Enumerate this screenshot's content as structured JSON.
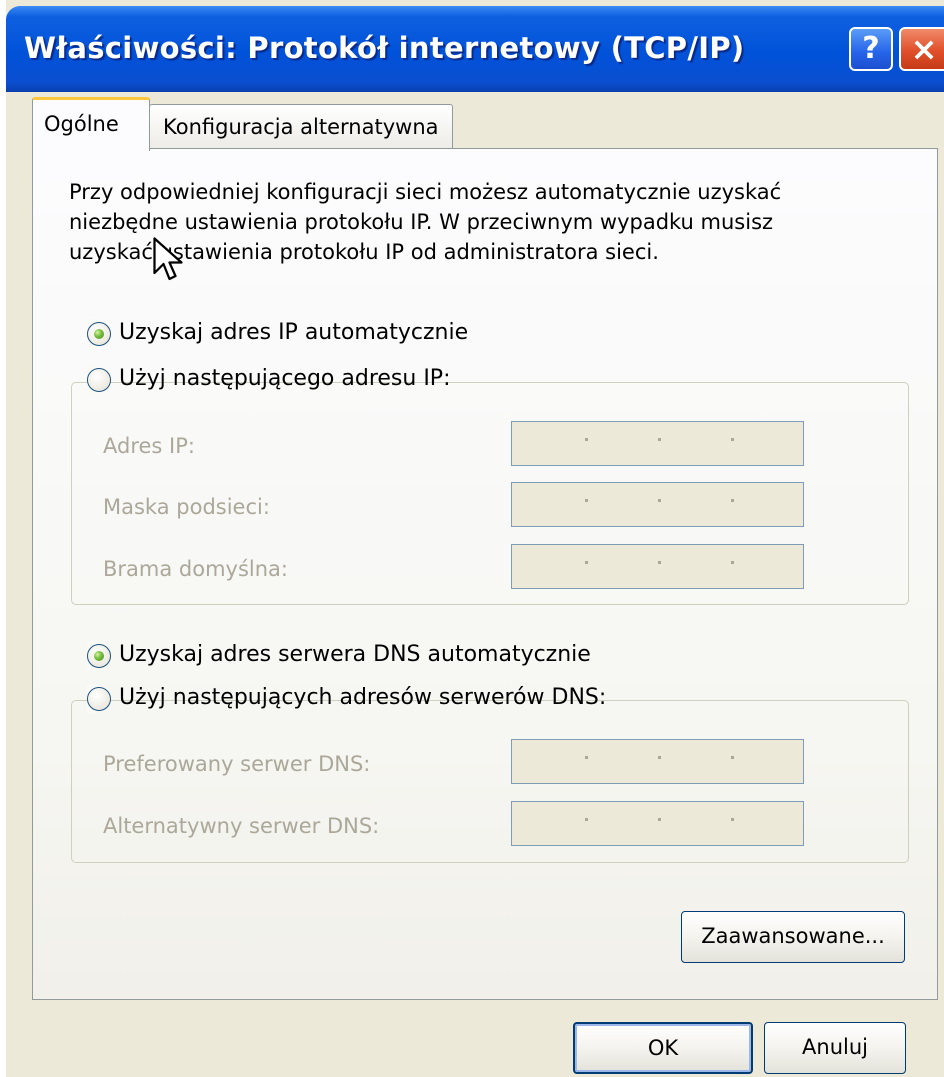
{
  "window": {
    "title": "Właściwości: Protokół internetowy (TCP/IP)",
    "help_label": "?",
    "close_label": "×"
  },
  "tabs": [
    {
      "label": "Ogólne",
      "active": true
    },
    {
      "label": "Konfiguracja alternatywna",
      "active": false
    }
  ],
  "description": {
    "line1": "Przy odpowiedniej konfiguracji sieci możesz automatycznie uzyskać",
    "line2": "niezbędne ustawienia protokołu IP. W przeciwnym wypadku musisz",
    "line3": "uzyskać ustawienia protokołu IP od administratora sieci."
  },
  "ip": {
    "auto_label": "Uzyskaj adres IP automatycznie",
    "auto_checked": true,
    "manual_label": "Użyj następującego adresu IP:",
    "manual_checked": false,
    "fields": [
      {
        "label": "Adres IP:",
        "value": ". . ."
      },
      {
        "label": "Maska podsieci:",
        "value": ". . ."
      },
      {
        "label": "Brama domyślna:",
        "value": ". . ."
      }
    ]
  },
  "dns": {
    "auto_label": "Uzyskaj adres serwera DNS automatycznie",
    "auto_checked": true,
    "manual_label": "Użyj następujących adresów serwerów DNS:",
    "manual_checked": false,
    "fields": [
      {
        "label": "Preferowany serwer DNS:",
        "value": ". . ."
      },
      {
        "label": "Alternatywny serwer DNS:",
        "value": ". . ."
      }
    ]
  },
  "buttons": {
    "advanced": "Zaawansowane...",
    "ok": "OK",
    "cancel": "Anuluj"
  },
  "colors": {
    "titlebar": "#0052d9",
    "dialog_bg": "#ece9d8",
    "disabled_text": "#aca899",
    "tab_highlight": "#ffc83c"
  }
}
